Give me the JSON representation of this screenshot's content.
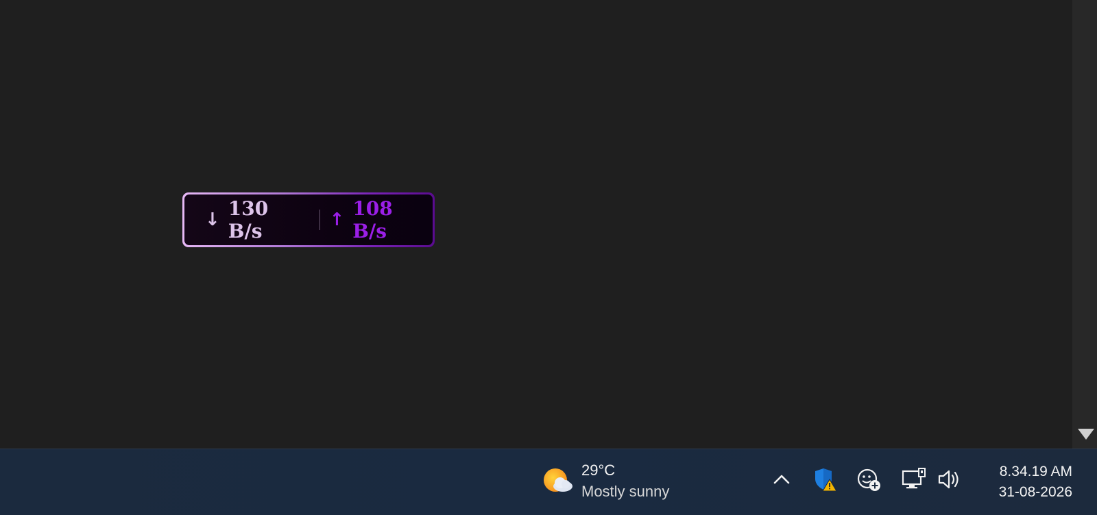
{
  "netspeed": {
    "download": "130 B/s",
    "upload": "108 B/s",
    "download_arrow": "↓",
    "upload_arrow": "↑",
    "download_color": "#ddc4ea",
    "upload_color": "#9b1fe8"
  },
  "taskbar": {
    "weather": {
      "temperature": "29°C",
      "condition": "Mostly sunny",
      "icon": "sun-cloud-icon"
    },
    "tray": {
      "icons": [
        "chevron-up-icon",
        "shield-warning-icon",
        "meet-now-icon",
        "network-icon",
        "volume-icon"
      ]
    },
    "clock": {
      "time": "8.34.19 AM",
      "date": "31-08-2026"
    }
  }
}
